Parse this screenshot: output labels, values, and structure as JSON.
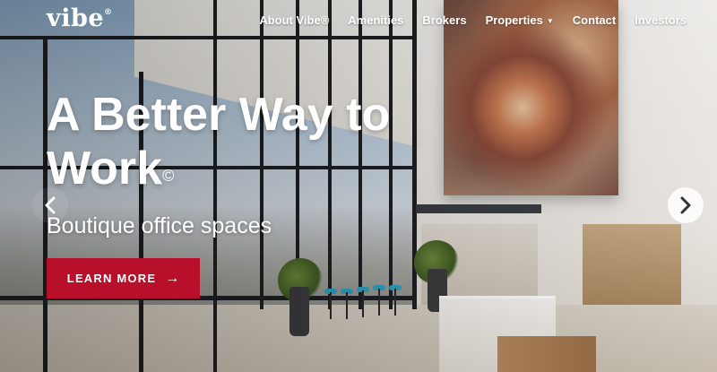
{
  "brand": {
    "logo_text": "vibe",
    "logo_mark": "®"
  },
  "nav": {
    "items": [
      {
        "label": "About Vibe®",
        "has_dropdown": false
      },
      {
        "label": "Amenities",
        "has_dropdown": false
      },
      {
        "label": "Brokers",
        "has_dropdown": false
      },
      {
        "label": "Properties",
        "has_dropdown": true
      },
      {
        "label": "Contact",
        "has_dropdown": false
      },
      {
        "label": "Investors",
        "has_dropdown": false
      }
    ],
    "dropdown_icon": "chevron-down-icon"
  },
  "hero": {
    "headline": "A Better Way to Work",
    "headline_mark": "©",
    "subheadline": "Boutique office spaces",
    "cta_label": "LEARN MORE",
    "cta_icon": "arrow-right-icon"
  },
  "carousel": {
    "prev_icon": "chevron-left-icon",
    "next_icon": "chevron-right-icon"
  },
  "colors": {
    "accent": "#b8102b",
    "text_on_image": "#ffffff"
  }
}
